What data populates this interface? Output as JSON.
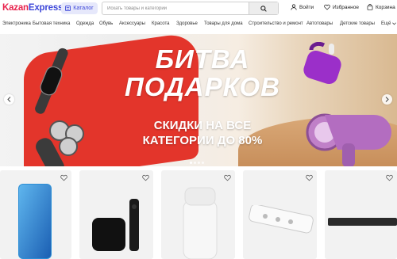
{
  "header": {
    "logo_part1": "Kazan",
    "logo_part2": "Express",
    "catalog_label": "Каталог",
    "search_placeholder": "Искать товары и категории",
    "login_label": "Войти",
    "favorites_label": "Избранное",
    "cart_label": "Корзина"
  },
  "nav": {
    "items": [
      "Электроника",
      "Бытовая техника",
      "Одежда",
      "Обувь",
      "Аксессуары",
      "Красота",
      "Здоровье",
      "Товары для дома",
      "Строительство и ремонт",
      "Автотовары",
      "Детские товары"
    ],
    "more_label": "Ещё"
  },
  "banner": {
    "title_line1": "БИТВА",
    "title_line2": "ПОДАРКОВ",
    "subtitle_line1": "СКИДКИ НА ВСЕ",
    "subtitle_line2": "КАТЕГОРИИ ДО 80%"
  },
  "colors": {
    "brand_pink": "#e8234d",
    "brand_purple": "#3d47d9",
    "banner_red": "#e3352b"
  },
  "icons": [
    "catalog-icon",
    "search-icon",
    "user-icon",
    "heart-icon",
    "bag-icon",
    "chevron-left-icon",
    "chevron-right-icon",
    "chevron-down-icon"
  ]
}
